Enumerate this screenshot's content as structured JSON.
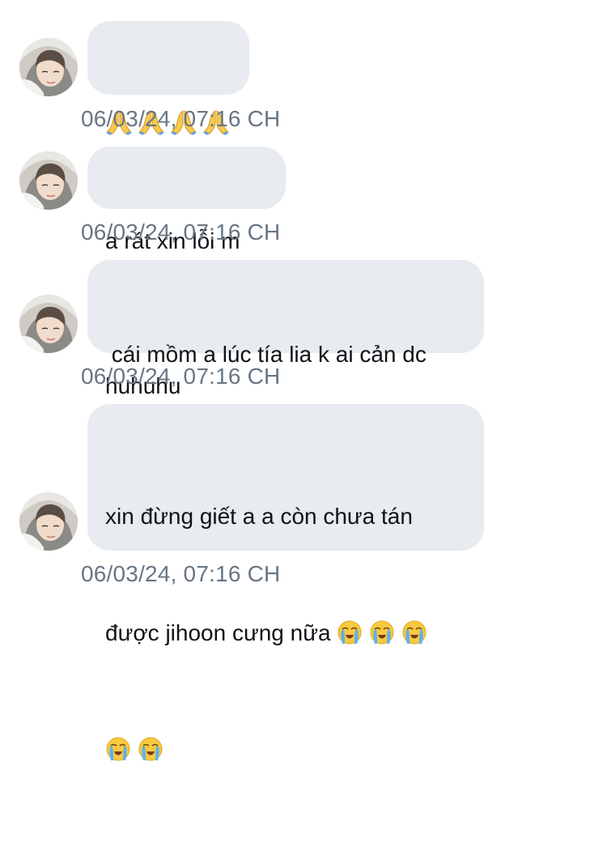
{
  "messages": [
    {
      "avatar_icon": "profile-photo-avatar",
      "text": "",
      "emojis": [
        "folded-hands-emoji",
        "folded-hands-emoji",
        "folded-hands-emoji",
        "folded-hands-emoji"
      ],
      "timestamp": "06/03/24, 07:16 CH"
    },
    {
      "avatar_icon": "profile-photo-avatar",
      "text": "a rát xin lỗi m",
      "timestamp": "06/03/24, 07:16 CH"
    },
    {
      "avatar_icon": "profile-photo-avatar",
      "text": " cái mồm a lúc tía lia k ai cản dc huhuhu",
      "timestamp": "06/03/24, 07:16 CH"
    },
    {
      "avatar_icon": "profile-photo-avatar",
      "text_line1": "xin đừng giết a a còn chưa tán",
      "text_line2": "được jihoon cưng nữa",
      "emojis": [
        "loudly-crying-face-emoji",
        "loudly-crying-face-emoji",
        "loudly-crying-face-emoji",
        "loudly-crying-face-emoji",
        "loudly-crying-face-emoji"
      ],
      "timestamp": "06/03/24, 07:16 CH"
    }
  ],
  "colors": {
    "bubble_background": "#e8ebef",
    "message_text": "#0f1419",
    "timestamp_text": "#687684",
    "page_background": "#ffffff"
  }
}
